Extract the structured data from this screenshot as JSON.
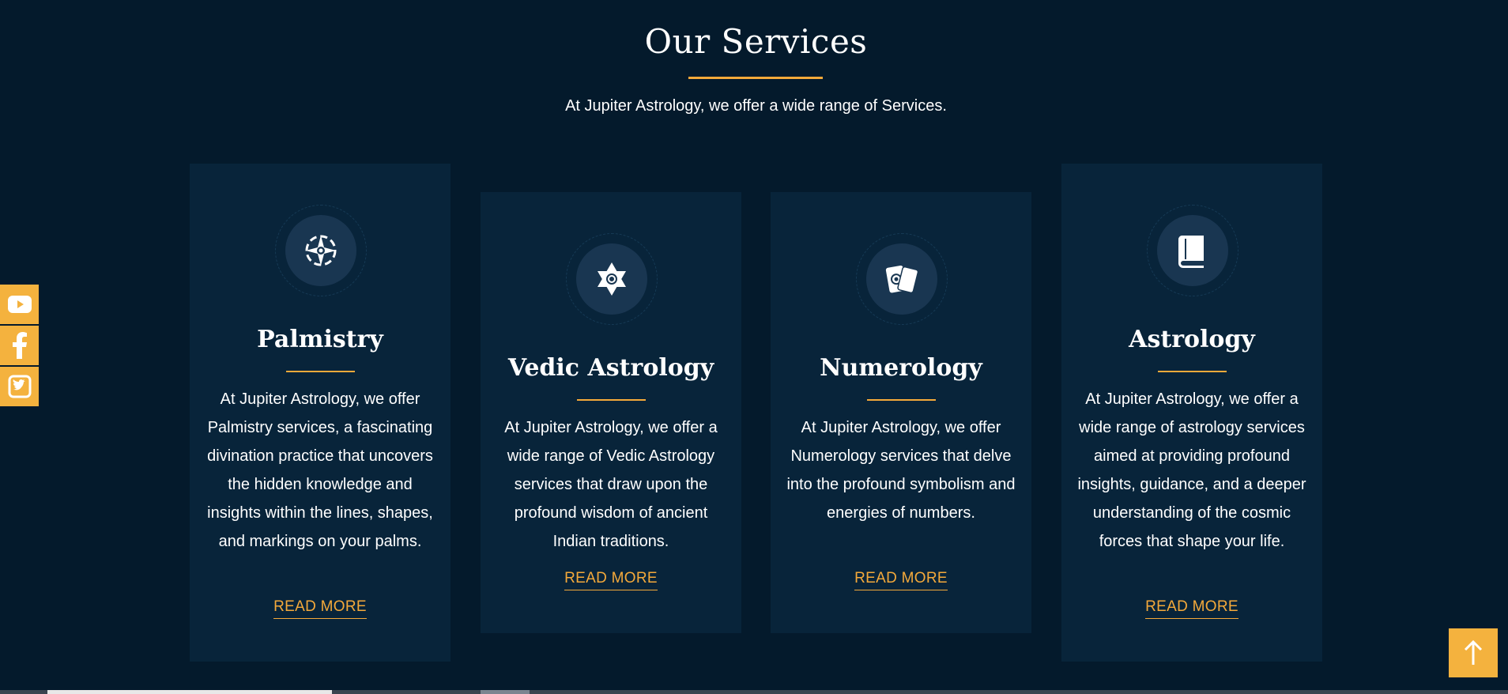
{
  "section": {
    "title": "Our Services",
    "subtitle": "At Jupiter Astrology, we offer a wide range of Services."
  },
  "cards": [
    {
      "title": "Palmistry",
      "icon": "compass-star-icon",
      "text": "At Jupiter Astrology, we offer Palmistry services, a fascinating divination practice that uncovers the hidden knowledge and insights within the lines, shapes, and markings on your palms.",
      "link": "READ MORE"
    },
    {
      "title": "Vedic Astrology",
      "icon": "hexagram-icon",
      "text": "At Jupiter Astrology, we offer a wide range of Vedic Astrology services that draw upon the profound wisdom of ancient Indian traditions.",
      "link": "READ MORE"
    },
    {
      "title": "Numerology",
      "icon": "tarot-cards-icon",
      "text": "At Jupiter Astrology, we offer Numerology services that delve into the profound symbolism and energies of numbers.",
      "link": "READ MORE"
    },
    {
      "title": "Astrology",
      "icon": "book-icon",
      "text": "At Jupiter Astrology, we offer a wide range of astrology services aimed at providing profound insights, guidance, and a deeper understanding of the cosmic forces that shape your life.",
      "link": "READ MORE"
    }
  ],
  "social": [
    "youtube-icon",
    "facebook-icon",
    "twitter-icon"
  ],
  "colors": {
    "background": "#041a2c",
    "card": "#08243a",
    "accent": "#f4a93a"
  }
}
